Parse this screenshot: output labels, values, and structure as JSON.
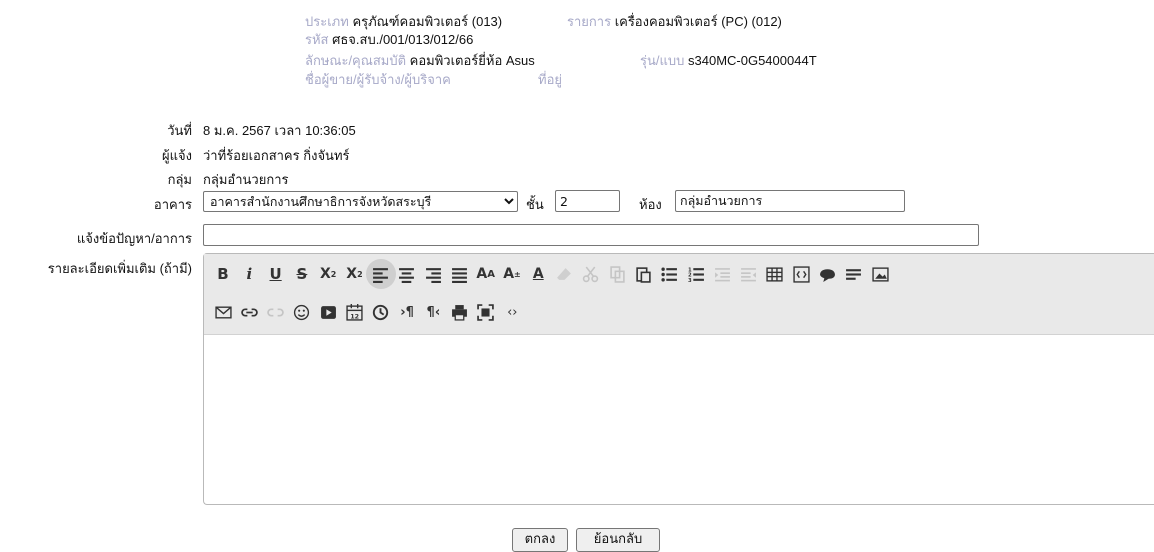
{
  "asset": {
    "type_label": "ประเภท",
    "type_value": "ครุภัณฑ์คอมพิวเตอร์ (013)",
    "item_label": "รายการ",
    "item_value": "เครื่องคอมพิวเตอร์ (PC) (012)",
    "code_label": "รหัส",
    "code_value": "ศธจ.สบ./001/013/012/66",
    "spec_label": "ลักษณะ/คุณสมบัติ",
    "spec_value": "คอมพิวเตอร์ยี่ห้อ Asus",
    "model_label": "รุ่น/แบบ",
    "model_value": "s340MC-0G5400044T",
    "vendor_label": "ชื่อผู้ขาย/ผู้รับจ้าง/ผู้บริจาค",
    "address_label": "ที่อยู่"
  },
  "form": {
    "date_label": "วันที่",
    "date_value": "8 ม.ค. 2567 เวลา 10:36:05",
    "reporter_label": "ผู้แจ้ง",
    "reporter_value": "ว่าที่ร้อยเอกสาคร กิ่งจันทร์",
    "group_label": "กลุ่ม",
    "group_value": "กลุ่มอำนวยการ",
    "building_label": "อาคาร",
    "building_selected": "อาคารสำนักงานศึกษาธิการจังหวัดสระบุรี",
    "floor_label": "ชั้น",
    "floor_value": "2",
    "room_label": "ห้อง",
    "room_value": "กลุ่มอำนวยการ",
    "problem_label": "แจ้งข้อปัญหา/อาการ",
    "problem_value": "",
    "details_label": "รายละเอียดเพิ่มเติม (ถ้ามี)"
  },
  "toolbar": {
    "row1": [
      "bold",
      "italic",
      "underline",
      "strikethrough",
      "subscript",
      "superscript",
      "align-left",
      "align-center",
      "align-right",
      "justify",
      "font-family",
      "font-size",
      "font-color",
      "eraser",
      "cut",
      "copy",
      "paste",
      "bullet-list",
      "numbered-list",
      "outdent",
      "indent",
      "table",
      "source",
      "comment",
      "horizontal-rule",
      "image"
    ],
    "row2": [
      "email",
      "link",
      "unlink",
      "emoji",
      "video",
      "date",
      "time",
      "ltr",
      "rtl",
      "print",
      "fullscreen",
      "code"
    ]
  },
  "buttons": {
    "ok_label": "ตกลง",
    "back_label": "ย้อนกลับ"
  }
}
